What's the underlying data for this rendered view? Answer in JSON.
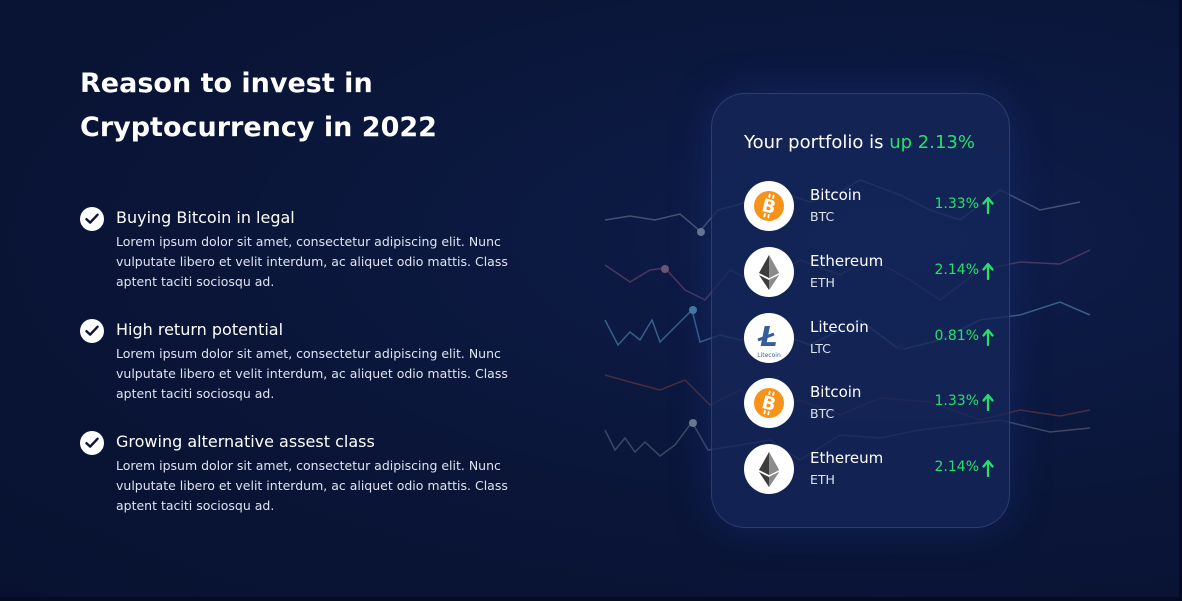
{
  "heading": {
    "title": "Reason to invest in Cryptocurrency in 2022"
  },
  "features": [
    {
      "title": "Buying Bitcoin in legal",
      "description": "Lorem ipsum dolor sit amet, consectetur adipiscing elit. Nunc vulputate libero et velit interdum, ac aliquet odio mattis. Class aptent taciti sociosqu ad."
    },
    {
      "title": "High return potential",
      "description": "Lorem ipsum dolor sit amet, consectetur adipiscing elit. Nunc vulputate libero et velit interdum, ac aliquet odio mattis. Class aptent taciti sociosqu ad."
    },
    {
      "title": "Growing alternative assest class",
      "description": "Lorem ipsum dolor sit amet, consectetur adipiscing elit. Nunc vulputate libero et velit interdum, ac aliquet odio mattis. Class aptent taciti sociosqu ad."
    }
  ],
  "portfolio": {
    "prefix": "Your portfolio is",
    "highlight": "up 2.13%",
    "coins": [
      {
        "name": "Bitcoin",
        "symbol": "BTC",
        "change": "1.33%",
        "icon": "bitcoin-icon"
      },
      {
        "name": "Ethereum",
        "symbol": "ETH",
        "change": "2.14%",
        "icon": "ethereum-icon"
      },
      {
        "name": "Litecoin",
        "symbol": "LTC",
        "change": "0.81%",
        "icon": "litecoin-icon",
        "icon_caption": "Litecoin"
      },
      {
        "name": "Bitcoin",
        "symbol": "BTC",
        "change": "1.33%",
        "icon": "bitcoin-icon"
      },
      {
        "name": "Ethereum",
        "symbol": "ETH",
        "change": "2.14%",
        "icon": "ethereum-icon"
      }
    ]
  },
  "colors": {
    "background": "#0a1538",
    "card": "#14265a",
    "positive": "#27e06a",
    "bitcoin": "#f7931a",
    "litecoin": "#345d9d",
    "ethereum": "#3c3c3d"
  }
}
